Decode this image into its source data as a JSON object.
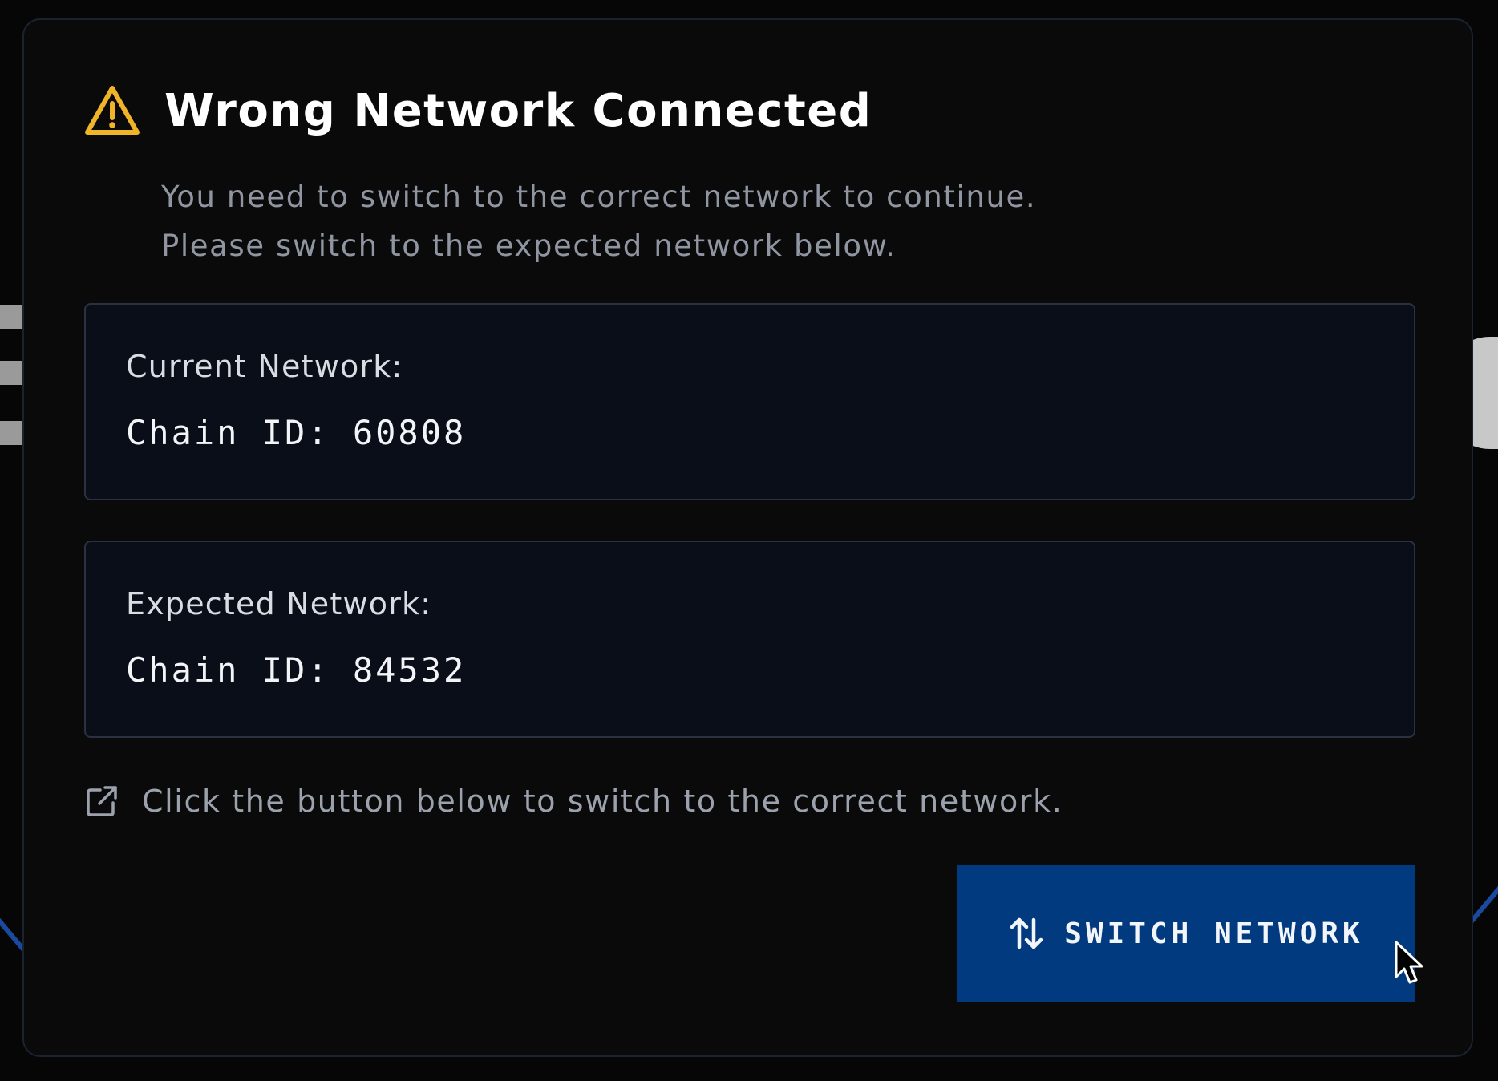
{
  "modal": {
    "title": "Wrong Network Connected",
    "description_line1": "You need to switch to the correct network to continue.",
    "description_line2": "Please switch to the expected network below.",
    "icon": "warning-triangle-icon",
    "accent_color": "#f0b429"
  },
  "current_network": {
    "label": "Current Network:",
    "chain_text": "Chain ID: 60808"
  },
  "expected_network": {
    "label": "Expected Network:",
    "chain_text": "Chain ID: 84532"
  },
  "hint": {
    "icon": "external-link-icon",
    "text": "Click the button below to switch to the correct network."
  },
  "switch_button": {
    "icon": "swap-vertical-icon",
    "label": "SWITCH NETWORK",
    "color": "#023a80"
  }
}
